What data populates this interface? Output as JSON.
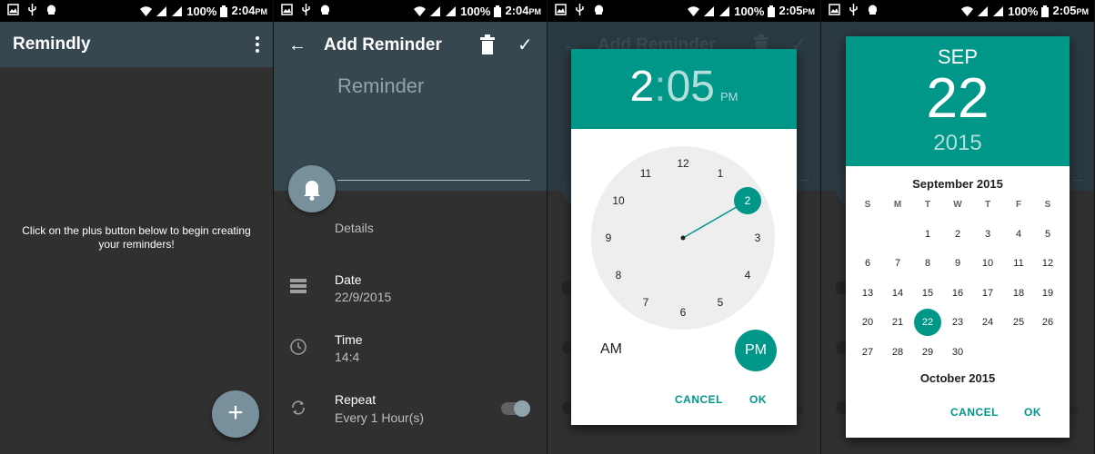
{
  "status_bar": {
    "battery": "100%",
    "times": [
      "2:04",
      "2:04",
      "2:05",
      "2:05"
    ],
    "ampm": "PM"
  },
  "screen1": {
    "app_title": "Remindly",
    "empty_message_line1": "Click on the plus button below to begin creating",
    "empty_message_line2": "your reminders!",
    "fab_label": "+"
  },
  "screen2": {
    "title": "Add Reminder",
    "title_placeholder": "Reminder",
    "details_label": "Details",
    "date_label": "Date",
    "date_value": "22/9/2015",
    "time_label": "Time",
    "time_value": "14:4",
    "repeat_label": "Repeat",
    "repeat_value": "Every 1 Hour(s)",
    "repeat_enabled": true
  },
  "underlay": {
    "title": "Add Reminder"
  },
  "time_picker": {
    "hour": "2",
    "separator": ":",
    "minute": "05",
    "ampm": "PM",
    "clock_numbers": [
      "12",
      "1",
      "2",
      "3",
      "4",
      "5",
      "6",
      "7",
      "8",
      "9",
      "10",
      "11"
    ],
    "selected_hour": "2",
    "am_label": "AM",
    "pm_label": "PM",
    "cancel_label": "CANCEL",
    "ok_label": "OK"
  },
  "date_picker": {
    "month_abbr": "SEP",
    "day": "22",
    "year": "2015",
    "month_title": "September 2015",
    "weekdays": [
      "S",
      "M",
      "T",
      "W",
      "T",
      "F",
      "S"
    ],
    "weeks": [
      [
        "",
        "",
        "1",
        "2",
        "3",
        "4",
        "5"
      ],
      [
        "6",
        "7",
        "8",
        "9",
        "10",
        "11",
        "12"
      ],
      [
        "13",
        "14",
        "15",
        "16",
        "17",
        "18",
        "19"
      ],
      [
        "20",
        "21",
        "22",
        "23",
        "24",
        "25",
        "26"
      ],
      [
        "27",
        "28",
        "29",
        "30",
        "",
        "",
        ""
      ]
    ],
    "selected_day": "22",
    "next_month_title": "October 2015",
    "cancel_label": "CANCEL",
    "ok_label": "OK"
  },
  "colors": {
    "accent": "#009688",
    "appbar": "#37474f",
    "fab": "#78909c",
    "background": "#303030"
  }
}
